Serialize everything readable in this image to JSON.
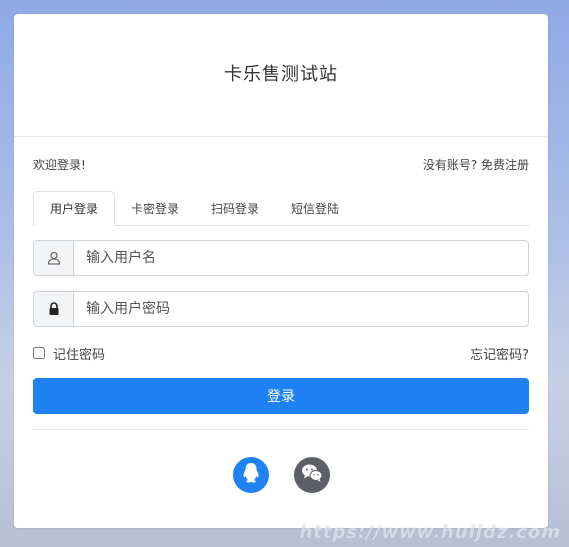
{
  "site": {
    "title": "卡乐售测试站"
  },
  "welcome": {
    "text": "欢迎登录!",
    "register_link": "没有账号? 免费注册"
  },
  "tabs": [
    {
      "label": "用户登录",
      "active": true
    },
    {
      "label": "卡密登录",
      "active": false
    },
    {
      "label": "扫码登录",
      "active": false
    },
    {
      "label": "短信登陆",
      "active": false
    }
  ],
  "form": {
    "username": {
      "placeholder": "输入用户名",
      "value": "",
      "icon": "user-icon"
    },
    "password": {
      "placeholder": "输入用户密码",
      "value": "",
      "icon": "lock-icon"
    },
    "remember_label": "记住密码",
    "remember_checked": false,
    "forgot_link": "忘记密码?",
    "submit_label": "登录"
  },
  "social": [
    {
      "name": "qq",
      "icon": "qq-icon",
      "color": "#1e82f5"
    },
    {
      "name": "wechat",
      "icon": "wechat-icon",
      "color": "#5c5f63"
    }
  ],
  "colors": {
    "primary": "#1e82f5",
    "background_top": "#8fa9e6",
    "card": "#ffffff"
  },
  "watermark": {
    "text": "https://www.huijdz.com"
  }
}
